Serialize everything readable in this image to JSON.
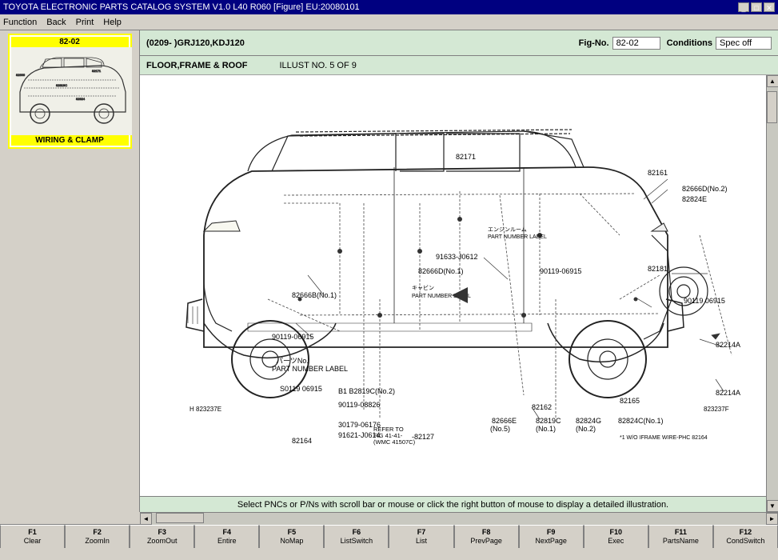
{
  "titleBar": {
    "title": "TOYOTA ELECTRONIC PARTS CATALOG SYSTEM V1.0 L40 R060 [Figure] EU:20080101",
    "buttons": [
      "_",
      "□",
      "✕"
    ]
  },
  "menuBar": {
    "items": [
      "Function",
      "Back",
      "Print",
      "Help"
    ]
  },
  "header": {
    "modelCode": "(0209-   )GRJ120,KDJ120",
    "figNo": {
      "label": "Fig-No.",
      "value": "82-02"
    },
    "conditions": {
      "label": "Conditions",
      "value": "Spec off"
    }
  },
  "subHeader": {
    "section": "FLOOR,FRAME & ROOF",
    "illustNo": "ILLUST NO. 5 OF 9"
  },
  "thumbnail": {
    "id": "82-02",
    "label": "WIRING & CLAMP"
  },
  "statusBar": {
    "message": "Select PNCs or P/Ns with scroll bar or mouse or click the right button of mouse to display a detailed illustration."
  },
  "functionKeys": [
    {
      "key": "F1",
      "label": "Clear"
    },
    {
      "key": "F2",
      "label": "ZoomIn"
    },
    {
      "key": "F3",
      "label": "ZoomOut"
    },
    {
      "key": "F4",
      "label": "Entire"
    },
    {
      "key": "F5",
      "label": "NoMap"
    },
    {
      "key": "F6",
      "label": "ListSwitch"
    },
    {
      "key": "F7",
      "label": "List"
    },
    {
      "key": "F8",
      "label": "PrevPage"
    },
    {
      "key": "F9",
      "label": "NextPage"
    },
    {
      "key": "F10",
      "label": "Exec"
    },
    {
      "key": "F11",
      "label": "PartsName"
    },
    {
      "key": "F12",
      "label": "CondSwitch"
    }
  ],
  "diagram": {
    "partNumbers": [
      "82171",
      "82161",
      "82666D(No.2)",
      "82824E",
      "82666D(No.1)",
      "91633-J0612",
      "91633 J0612",
      "90119-06915",
      "82181",
      "82666B(No.1)",
      "90119-06915",
      "90119 06915",
      "B1 B2819C(No.2)",
      "90119-08826",
      "30179-06176",
      "91621-J0614",
      "82164",
      "82127",
      "82666E(No.5)",
      "82819C(No.1)",
      "82824G(No.2)",
      "82824C(No.1)",
      "82162",
      "82165",
      "82214A",
      "82214A",
      "H 823237E",
      "823237F",
      "PART NUMBER LABEL",
      "PART NUMBER LABEL",
      "S0119 06915",
      "REFER TO FIG 41-41- (WMC 41507C)",
      "*1 W/O IFRAME WIRE-PHC 82164"
    ]
  }
}
